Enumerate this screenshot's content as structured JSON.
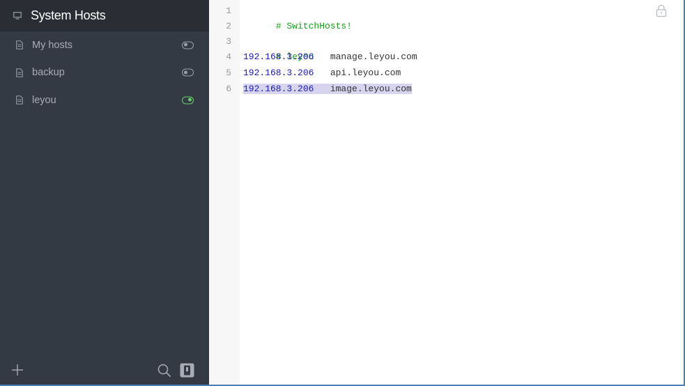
{
  "sidebar": {
    "system_hosts": {
      "label": "System Hosts",
      "icon": "monitor-icon"
    },
    "items": [
      {
        "label": "My hosts",
        "icon": "document-icon",
        "enabled": false
      },
      {
        "label": "backup",
        "icon": "document-icon",
        "enabled": false
      },
      {
        "label": "leyou",
        "icon": "document-icon",
        "enabled": true
      }
    ],
    "footer": {
      "add_icon": "plus-icon",
      "search_icon": "search-icon",
      "prefs_icon": "preferences-icon"
    }
  },
  "editor": {
    "lock_icon": "lock-icon",
    "lines": [
      {
        "num": "1",
        "comment": "# SwitchHosts!"
      },
      {
        "num": "2"
      },
      {
        "num": "3",
        "comment": "# leyou"
      },
      {
        "num": "4",
        "ip": "192.168.3.206",
        "host": "manage.leyou.com"
      },
      {
        "num": "5",
        "ip": "192.168.3.206",
        "host": "api.leyou.com"
      },
      {
        "num": "6",
        "ip": "192.168.3.206",
        "host": "image.leyou.com"
      }
    ]
  },
  "colors": {
    "comment": "#179e17",
    "ip": "#1a1aa6",
    "toggle_on": "#6bcf6f",
    "sidebar_bg": "#343a43",
    "selection": "#d7d4f0"
  }
}
